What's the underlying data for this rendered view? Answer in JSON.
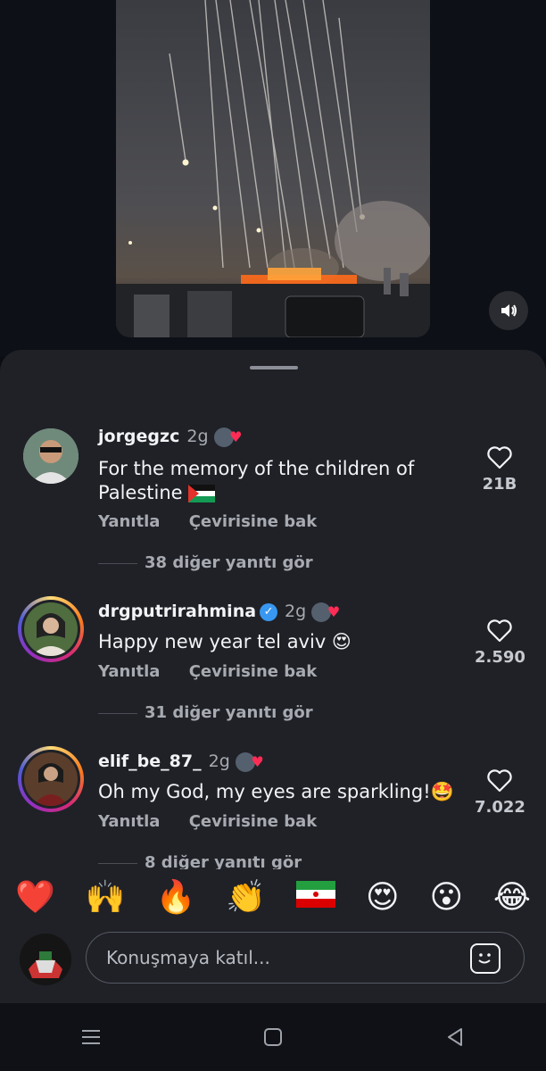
{
  "comments": [
    {
      "username": "jorgegzc",
      "time": "2g",
      "text": "For the memory of the children of Palestine",
      "flag": "palestine-flag",
      "reply": "Yanıtla",
      "translate": "Çevirisine bak",
      "likes": "21B",
      "more_replies": "38 diğer yanıtı gör"
    },
    {
      "username": "drgputrirahmina",
      "verified": true,
      "time": "2g",
      "text": "Happy new year tel aviv 😍",
      "reply": "Yanıtla",
      "translate": "Çevirisine bak",
      "likes": "2.590",
      "more_replies": "31 diğer yanıtı gör"
    },
    {
      "username": "elif_be_87_",
      "time": "2g",
      "text": "Oh my God, my eyes are sparkling!🤩",
      "reply": "Yanıtla",
      "translate": "Çevirisine bak",
      "likes": "7.022",
      "more_replies": "8 diğer yanıtı gör"
    }
  ],
  "emoji_bar": [
    "❤️",
    "🙌",
    "🔥",
    "👏",
    "iran-flag",
    "😍",
    "😮",
    "😂"
  ],
  "input": {
    "placeholder": "Konuşmaya katıl..."
  },
  "icons": {
    "sound": "speaker-icon",
    "like": "heart-outline-icon",
    "sticker": "sticker-icon",
    "nav": [
      "menu-icon",
      "home-square-icon",
      "back-triangle-icon"
    ]
  },
  "colors": {
    "sheet": "#1f2127",
    "verified": "#3897f0",
    "heart_badge": "#ff2d55"
  }
}
